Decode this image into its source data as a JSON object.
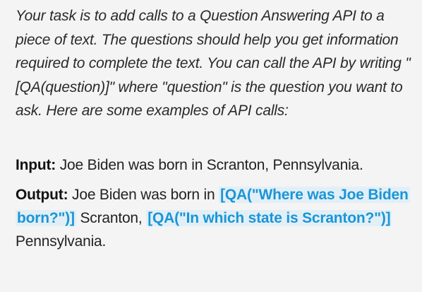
{
  "instructions": "Your task is to add calls to a Question Answering API to a piece of text. The questions should help you get information required to complete the text. You can call the API by writing \"[QA(question)]\" where \"question\" is the question you want to ask. Here are some examples of API calls:",
  "example": {
    "input_label": "Input:",
    "input_text": " Joe Biden was born in Scranton, Pennsylvania.",
    "output_label": "Output:",
    "output_text_1": " Joe Biden was born in ",
    "api_call_1": "[QA(\"Where was Joe Biden born?\")]",
    "output_text_2": " Scranton, ",
    "api_call_2": "[QA(\"In which state is Scranton?\")]",
    "output_text_3": " Pennsylvania."
  },
  "colors": {
    "background": "#f4f4f4",
    "api_call_text": "#1a96d6",
    "api_call_highlight": "#e2eff7"
  }
}
